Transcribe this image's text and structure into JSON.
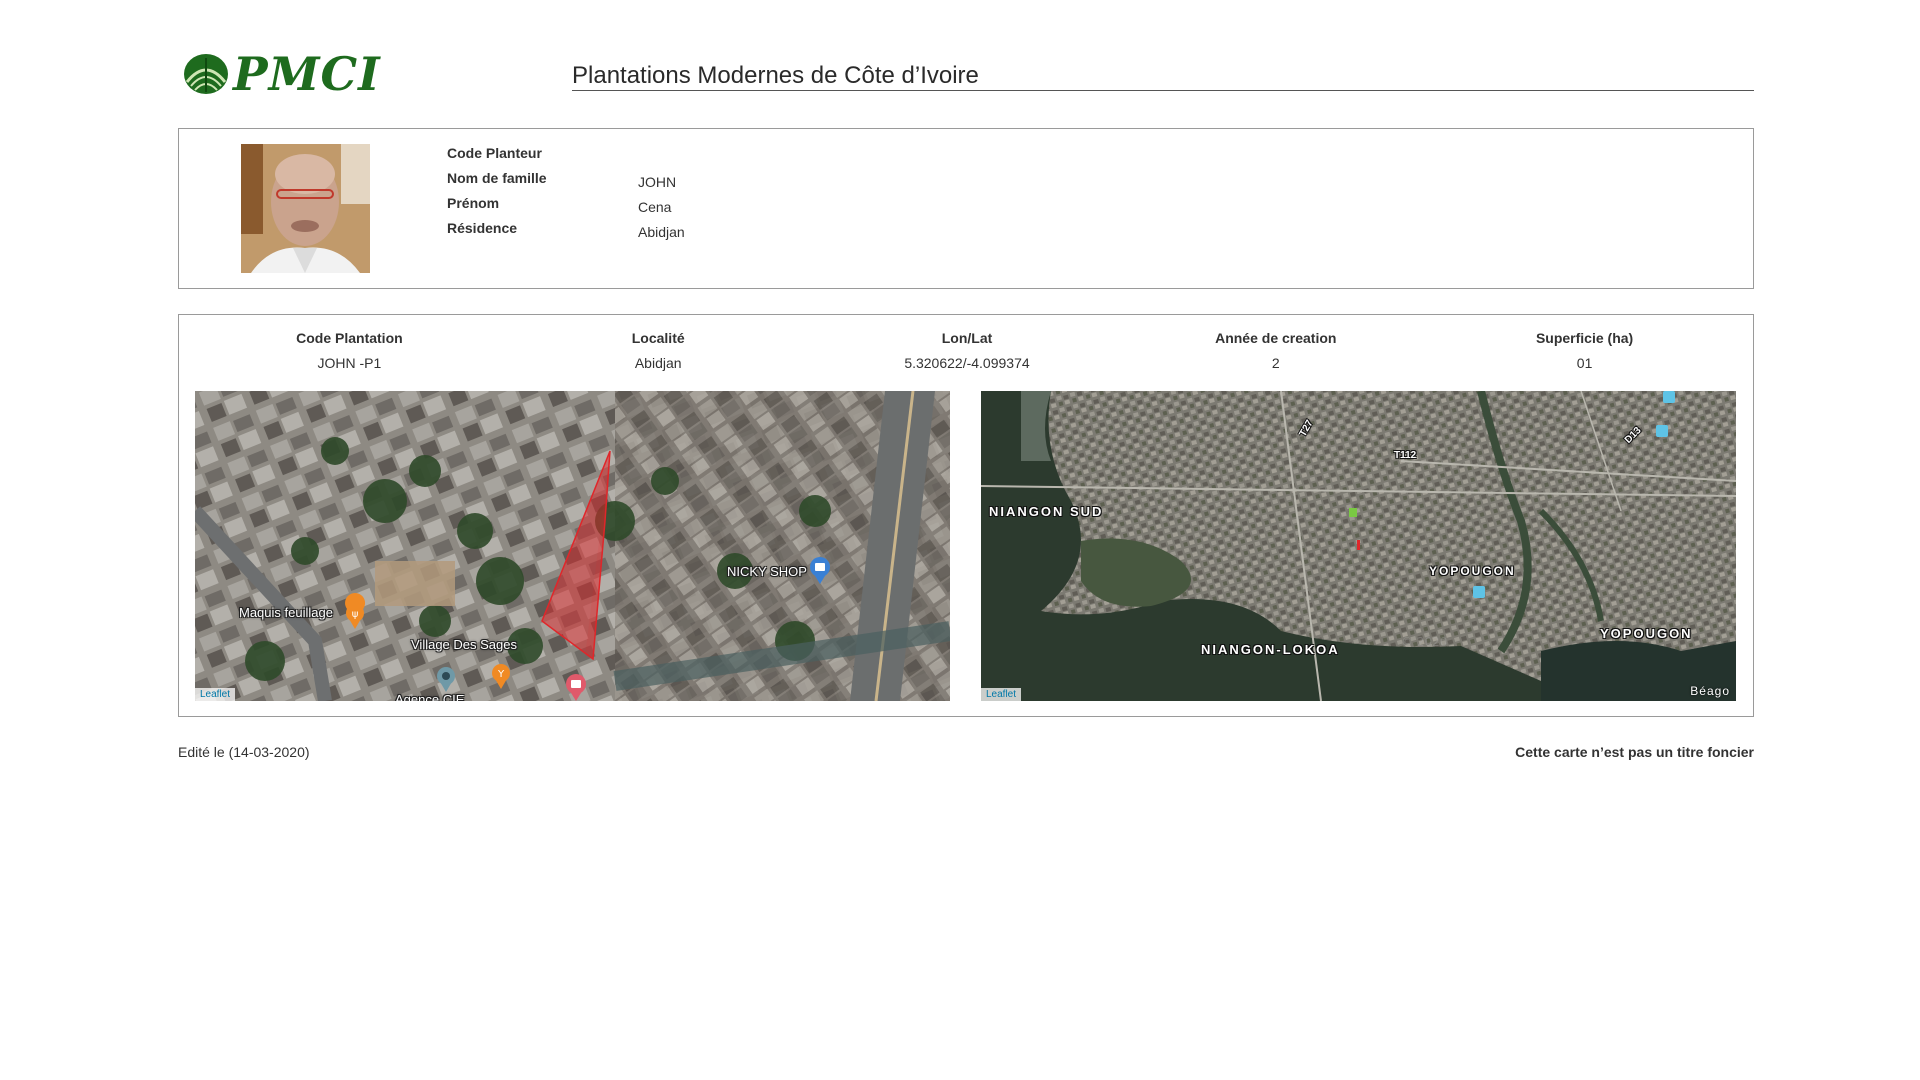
{
  "header": {
    "logo_text": "PMCI",
    "title": "Plantations Modernes de Côte d’Ivoire"
  },
  "planter": {
    "fields": [
      {
        "label": "Code Planteur",
        "value": ""
      },
      {
        "label": "Nom de famille",
        "value": "JOHN"
      },
      {
        "label": "Prénom",
        "value": "Cena"
      },
      {
        "label": "Résidence",
        "value": "Abidjan"
      }
    ]
  },
  "plantation": {
    "columns": [
      {
        "header": "Code Plantation",
        "value": "JOHN -P1"
      },
      {
        "header": "Localité",
        "value": "Abidjan"
      },
      {
        "header": "Lon/Lat",
        "value": "5.320622/-4.099374"
      },
      {
        "header": "Année de creation",
        "value": "2"
      },
      {
        "header": "Superficie (ha)",
        "value": "01"
      }
    ]
  },
  "map_left": {
    "attribution": "Leaflet",
    "pois": [
      "Maquis feuillage",
      "Village Des Sages",
      "NICKY SHOP",
      "Agence CIE"
    ]
  },
  "map_right": {
    "attribution": "Leaflet",
    "copyright": "Béago",
    "areas": [
      "NIANGON SUD",
      "YOPOUGON",
      "NIANGON-LOKOA",
      "YOPOUGON"
    ],
    "roads": [
      "T27",
      "T112",
      "D13"
    ]
  },
  "footer": {
    "edited": "Edité le (14-03-2020)",
    "disclaimer": "Cette carte n’est pas un titre foncier"
  },
  "colors": {
    "brand_green": "#1e6b1e",
    "parcel_red": "#e0262a"
  }
}
